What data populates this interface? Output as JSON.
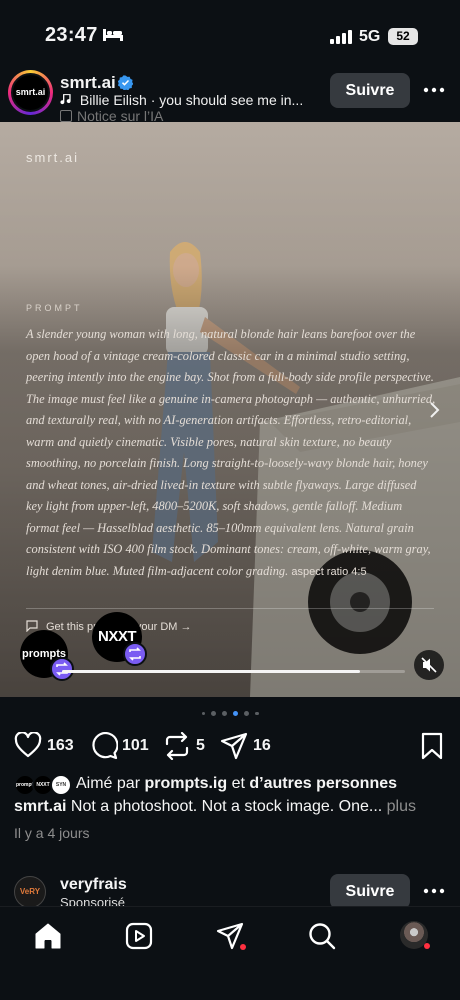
{
  "status_bar": {
    "time": "23:47",
    "network": "5G",
    "battery": "52"
  },
  "post": {
    "username": "smrt.ai",
    "avatar_text": "smrt.ai",
    "music": "Billie Eilish · you should see me in...",
    "ai_label": "Notice sur l’IA",
    "follow_label": "Suivre",
    "media": {
      "brand": "smrt.ai",
      "prompt_label": "PROMPT",
      "prompt_text": "A slender young woman with long, natural blonde hair leans barefoot over the open hood of a vintage cream-colored classic car in a minimal studio setting, peering intently into the engine bay. Shot from a full-body side profile perspective. The image must feel like a genuine in-camera photograph — authentic, unhurried, and texturally real, with no AI-generation artifacts. Effortless, retro-editorial, warm and quietly cinematic. Visible pores, natural skin texture, no beauty smoothing, no porcelain finish. Long straight-to-loosely-wavy blonde hair, honey and wheat tones, air-dried lived-in texture with subtle flyaways. Large diffused key light from upper-left, 4800–5200K, soft shadows, gentle falloff. Medium format feel — Hasselblad aesthetic. 85–100mm equivalent lens. Natural grain consistent with ISO 400 film stock. Dominant tones: cream, off-white, warm gray, light denim blue. Muted film-adjacent color grading.",
      "aspect": "aspect ratio 4:5",
      "dm_line": "Get this prompt in your DM →",
      "collab1": "prompts",
      "collab2": "NXXT",
      "progress": 0.87
    },
    "carousel": {
      "count": 6,
      "active": 4
    },
    "actions": {
      "likes": "163",
      "comments": "101",
      "reposts": "5",
      "shares": "16"
    },
    "liked_by": {
      "mini_avatars": [
        "prompts",
        "NXXT",
        "SYN"
      ],
      "prefix": "Aimé par",
      "user": "prompts.ig",
      "conj": "et",
      "others": "d’autres personnes"
    },
    "caption": {
      "username": "smrt.ai",
      "text": "Not a photoshoot. Not a stock image. One...",
      "more": "plus"
    },
    "time_ago": "Il y a 4 jours"
  },
  "next_post": {
    "username": "veryfrais",
    "subtitle": "Sponsorisé",
    "avatar_text": "VeRY",
    "follow_label": "Suivre"
  },
  "colors": {
    "background": "#0c1014",
    "accent": "#4493f8",
    "repost": "#7a5cf2",
    "notification": "#ff3040",
    "button": "#363a3f"
  },
  "icons": [
    "bed-icon",
    "signal-icon",
    "verified-icon",
    "music-icon",
    "more-icon",
    "chevron-right-icon",
    "repost-icon",
    "mute-icon",
    "heart-icon",
    "comment-icon",
    "share-icon",
    "bookmark-icon",
    "home-icon",
    "reels-icon",
    "messages-icon",
    "search-icon"
  ]
}
